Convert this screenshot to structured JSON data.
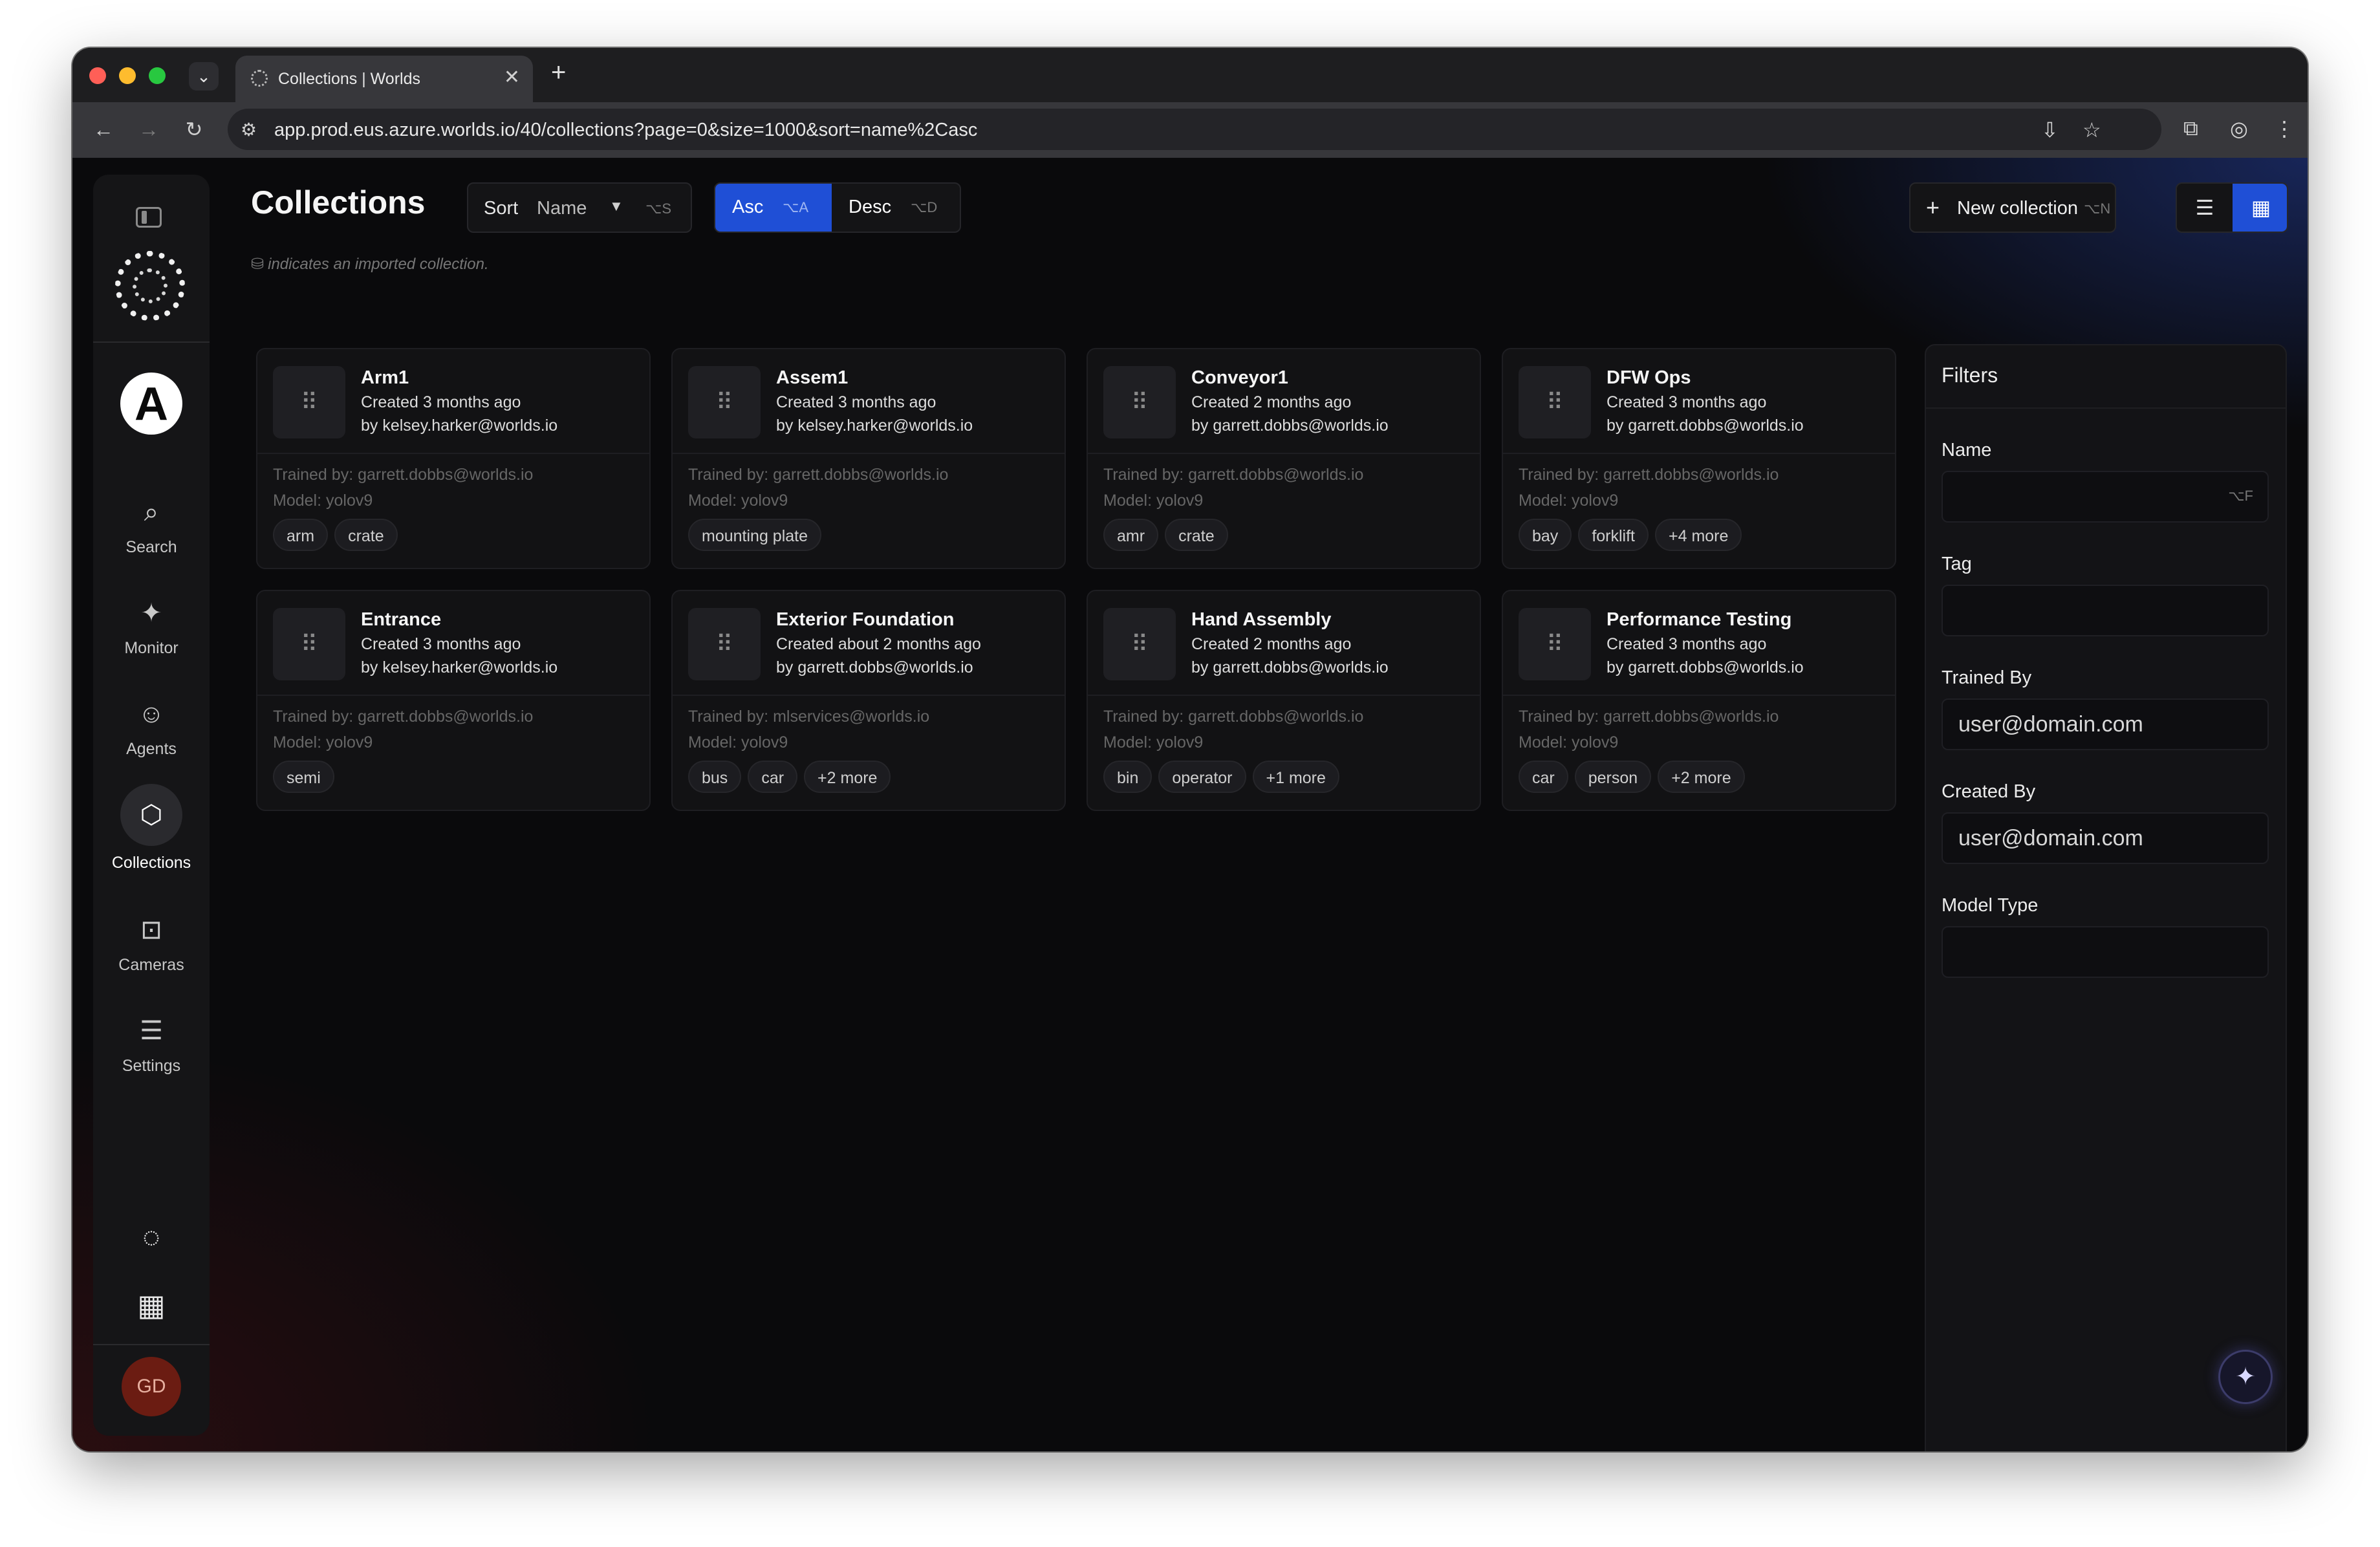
{
  "browser": {
    "tab_title": "Collections | Worlds",
    "tab_close": "✕",
    "new_tab": "+",
    "url": "app.prod.eus.azure.worlds.io/40/collections?page=0&size=1000&sort=name%2Casc"
  },
  "sidebar": {
    "org_initial": "A",
    "items": [
      {
        "label": "Search",
        "icon": "search-icon",
        "glyph": "⌕"
      },
      {
        "label": "Monitor",
        "icon": "monitor-icon",
        "glyph": "✦"
      },
      {
        "label": "Agents",
        "icon": "robot-icon",
        "glyph": "☺"
      },
      {
        "label": "Collections",
        "icon": "cube-icon",
        "glyph": "⬡"
      },
      {
        "label": "Cameras",
        "icon": "camera-icon",
        "glyph": "⊡"
      },
      {
        "label": "Settings",
        "icon": "sliders-icon",
        "glyph": "☰"
      }
    ],
    "active": "Collections",
    "user_initials": "GD"
  },
  "header": {
    "title": "Collections",
    "sort_label": "Sort",
    "sort_value": "Name",
    "sort_shortcut": "⌥S",
    "asc_label": "Asc",
    "asc_shortcut": "⌥A",
    "desc_label": "Desc",
    "desc_shortcut": "⌥D",
    "new_collection_label": "New collection",
    "new_collection_shortcut": "⌥N",
    "hint": "indicates an imported collection.",
    "view_mode": "grid"
  },
  "collections": [
    {
      "name": "Arm1",
      "created": "Created 3 months ago",
      "by": "by kelsey.harker@worlds.io",
      "trained_by": "Trained by: garrett.dobbs@worlds.io",
      "model": "Model: yolov9",
      "tags": [
        "arm",
        "crate"
      ]
    },
    {
      "name": "Assem1",
      "created": "Created 3 months ago",
      "by": "by kelsey.harker@worlds.io",
      "trained_by": "Trained by: garrett.dobbs@worlds.io",
      "model": "Model: yolov9",
      "tags": [
        "mounting plate"
      ]
    },
    {
      "name": "Conveyor1",
      "created": "Created 2 months ago",
      "by": "by garrett.dobbs@worlds.io",
      "trained_by": "Trained by: garrett.dobbs@worlds.io",
      "model": "Model: yolov9",
      "tags": [
        "amr",
        "crate"
      ]
    },
    {
      "name": "DFW Ops",
      "created": "Created 3 months ago",
      "by": "by garrett.dobbs@worlds.io",
      "trained_by": "Trained by: garrett.dobbs@worlds.io",
      "model": "Model: yolov9",
      "tags": [
        "bay",
        "forklift",
        "+4 more"
      ]
    },
    {
      "name": "Entrance",
      "created": "Created 3 months ago",
      "by": "by kelsey.harker@worlds.io",
      "trained_by": "Trained by: garrett.dobbs@worlds.io",
      "model": "Model: yolov9",
      "tags": [
        "semi"
      ]
    },
    {
      "name": "Exterior Foundation",
      "created": "Created about 2 months ago",
      "by": "by garrett.dobbs@worlds.io",
      "trained_by": "Trained by: mlservices@worlds.io",
      "model": "Model: yolov9",
      "tags": [
        "bus",
        "car",
        "+2 more"
      ]
    },
    {
      "name": "Hand Assembly",
      "created": "Created 2 months ago",
      "by": "by garrett.dobbs@worlds.io",
      "trained_by": "Trained by: garrett.dobbs@worlds.io",
      "model": "Model: yolov9",
      "tags": [
        "bin",
        "operator",
        "+1 more"
      ]
    },
    {
      "name": "Performance Testing",
      "created": "Created 3 months ago",
      "by": "by garrett.dobbs@worlds.io",
      "trained_by": "Trained by: garrett.dobbs@worlds.io",
      "model": "Model: yolov9",
      "tags": [
        "car",
        "person",
        "+2 more"
      ]
    }
  ],
  "filters": {
    "title": "Filters",
    "name_label": "Name",
    "name_value": "",
    "name_shortcut": "⌥F",
    "tag_label": "Tag",
    "tag_value": "",
    "trained_by_label": "Trained By",
    "trained_by_placeholder": "user@domain.com",
    "created_by_label": "Created By",
    "created_by_placeholder": "user@domain.com",
    "model_type_label": "Model Type",
    "model_type_value": ""
  },
  "colors": {
    "accent": "#1f4fd6",
    "background": "#0a0a0c",
    "card": "#121214"
  }
}
